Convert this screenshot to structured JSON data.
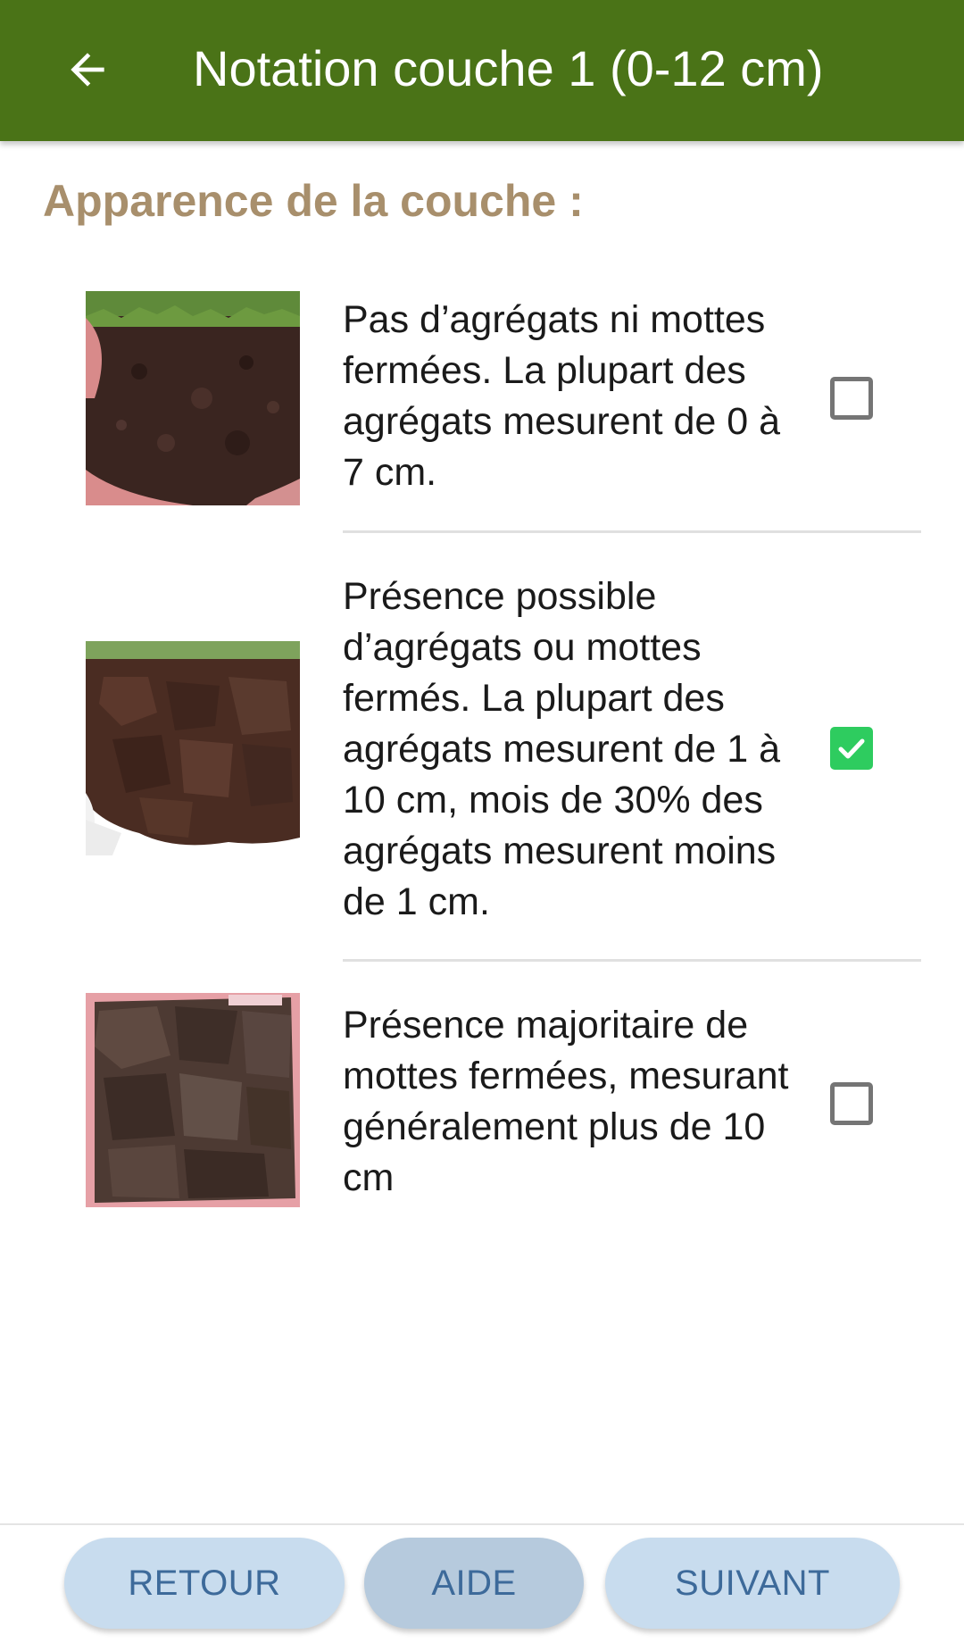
{
  "header": {
    "title": "Notation couche 1 (0-12 cm)",
    "back_icon": "arrow-back-icon",
    "background_color": "#4a7317"
  },
  "section": {
    "title": "Apparence de la couche :"
  },
  "options": [
    {
      "text": "Pas d’agrégats ni mottes fermées. La plupart des agrégats mesurent de 0 à 7 cm.",
      "checked": false
    },
    {
      "text": "Présence possible d’agrégats ou mottes fermés. La plupart des agrégats mesurent de 1 à 10 cm, mois de 30% des agrégats mesurent moins de 1 cm.",
      "checked": true
    },
    {
      "text": "Présence majoritaire de mottes fermées, mesurant généralement plus de 10 cm",
      "checked": false
    }
  ],
  "footer": {
    "retour_label": "RETOUR",
    "aide_label": "AIDE",
    "suivant_label": "SUIVANT"
  },
  "colors": {
    "accent_green": "#4a7317",
    "section_title": "#a88f6c",
    "checkbox_checked": "#2ecc5f",
    "button_bg": "#c8dcee",
    "button_text": "#3d6a9a"
  }
}
